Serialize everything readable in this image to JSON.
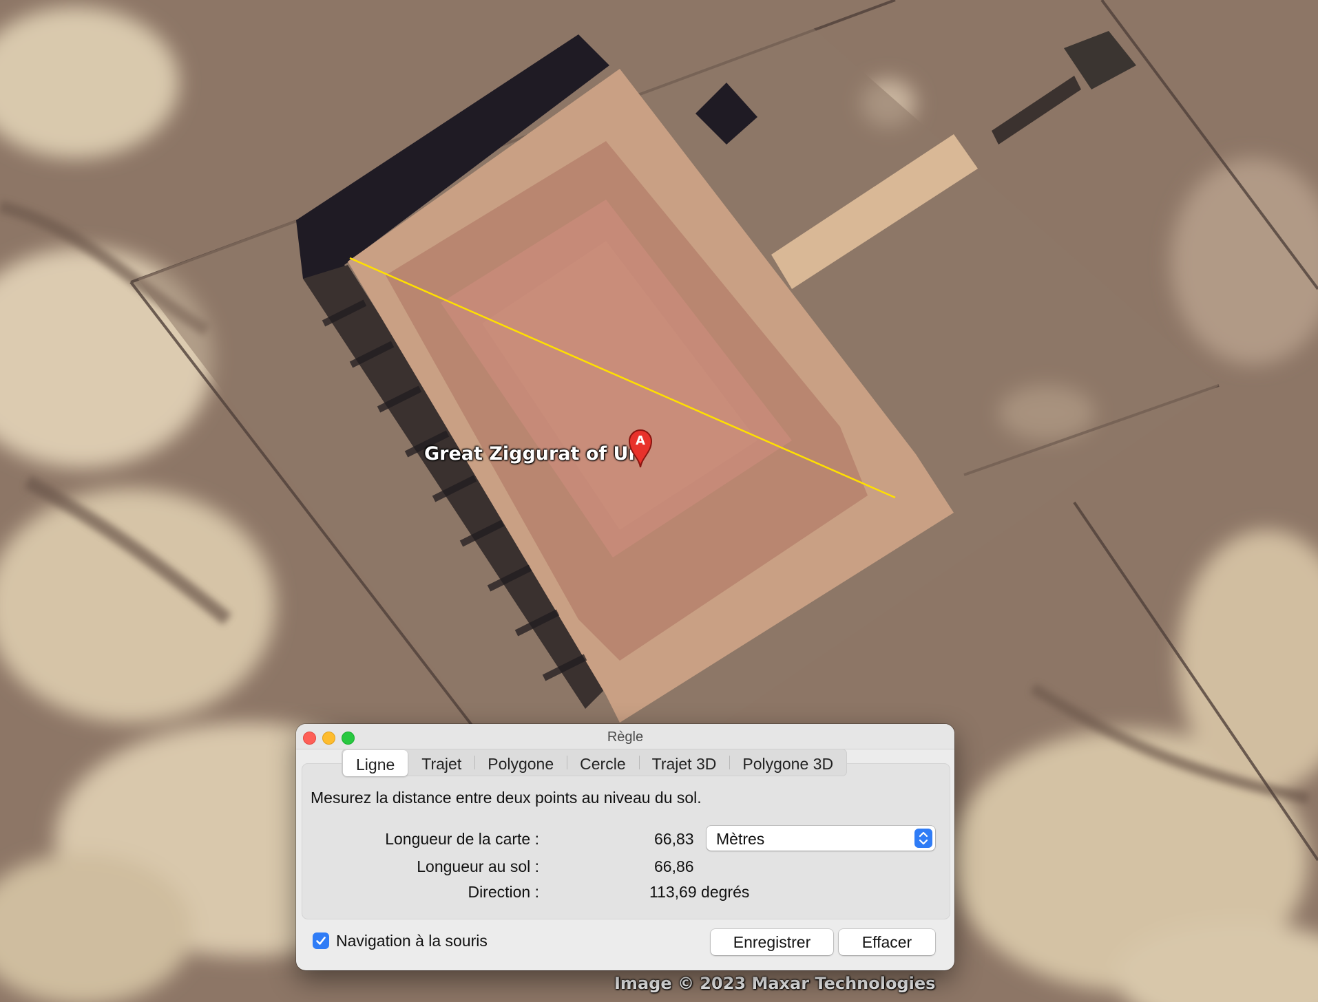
{
  "map": {
    "placemark": {
      "label": "Great Ziggurat of Ur",
      "pin_letter": "A",
      "icon": "red-placemark-pin-icon"
    },
    "copyright": "Image © 2023 Maxar Technologies",
    "measure_line_color": "#ffe000"
  },
  "dialog": {
    "title": "Règle",
    "window_buttons": [
      "close",
      "minimize",
      "zoom"
    ],
    "tabs": [
      {
        "label": "Ligne",
        "active": true
      },
      {
        "label": "Trajet",
        "active": false
      },
      {
        "label": "Polygone",
        "active": false
      },
      {
        "label": "Cercle",
        "active": false
      },
      {
        "label": "Trajet 3D",
        "active": false
      },
      {
        "label": "Polygone 3D",
        "active": false
      }
    ],
    "description": "Mesurez la distance entre deux points au niveau du sol.",
    "map_length": {
      "label": "Longueur de la carte :",
      "value": "66,83"
    },
    "unit_select": {
      "selected": "Mètres",
      "icon": "up-down-chevron-icon"
    },
    "ground_length": {
      "label": "Longueur au sol :",
      "value": "66,86"
    },
    "heading": {
      "label": "Direction :",
      "value": "113,69 degrés"
    },
    "mouse_navigation": {
      "label": "Navigation à la souris",
      "checked": true
    },
    "save_label": "Enregistrer",
    "clear_label": "Effacer"
  },
  "colors": {
    "accent": "#2f7cf6",
    "close": "#fe5f57",
    "minimize": "#febc2e",
    "zoom": "#28c840",
    "pin": "#e8322b"
  }
}
